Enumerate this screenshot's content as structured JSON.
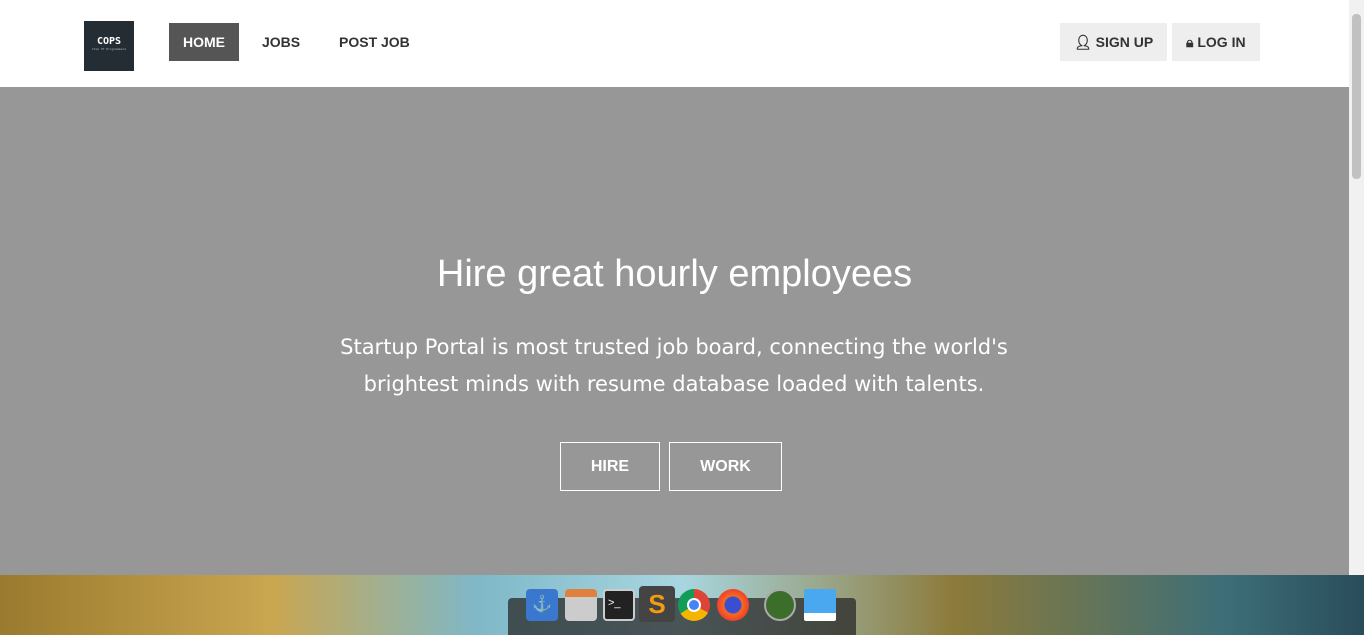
{
  "nav": {
    "logo": "COPS",
    "logo_sub": "Club Of Programmers",
    "items": [
      {
        "label": "HOME",
        "active": true
      },
      {
        "label": "JOBS"
      },
      {
        "label": "POST JOB"
      }
    ],
    "signup": "SIGN UP",
    "login": "LOG IN"
  },
  "hero": {
    "title": "Hire great hourly employees",
    "subtitle": "Startup Portal is most trusted job board, connecting the world's brightest minds with resume database loaded with talents.",
    "hire": "HIRE",
    "work": "WORK",
    "background": "#979797"
  },
  "dock": {
    "apps": [
      "anchor-icon",
      "file-cabinet-icon",
      "terminal-icon",
      "sublime-text-icon",
      "chrome-icon",
      "firefox-icon",
      "radar-icon",
      "window-icon"
    ]
  }
}
